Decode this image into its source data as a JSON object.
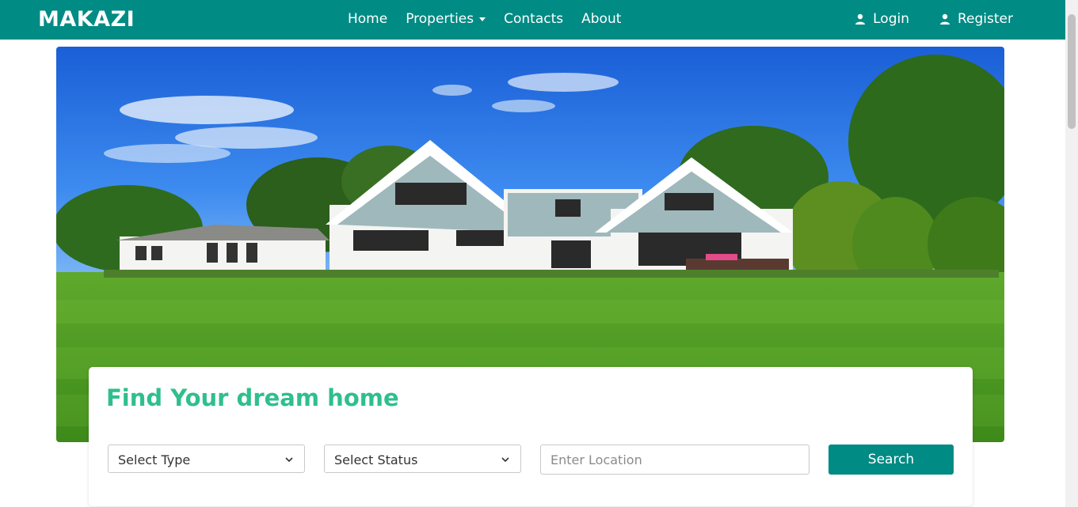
{
  "nav": {
    "brand": "MAKAZI",
    "links": [
      "Home",
      "Properties",
      "Contacts",
      "About"
    ],
    "login": "Login",
    "register": "Register"
  },
  "hero": {
    "image": "house-with-lawn-photo"
  },
  "search": {
    "title": "Find Your dream home",
    "type_select": "Select Type",
    "status_select": "Select Status",
    "location_placeholder": "Enter Location",
    "button": "Search"
  },
  "colors": {
    "primary": "#008b84",
    "title_green": "#2fbf8c"
  }
}
